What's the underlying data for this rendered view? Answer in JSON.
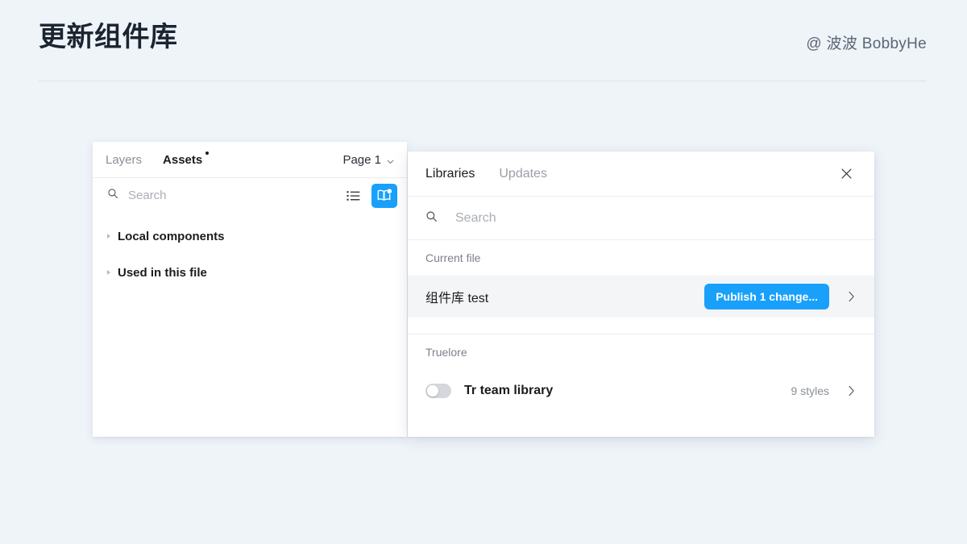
{
  "slide": {
    "title": "更新组件库",
    "author": "@ 波波 BobbyHe"
  },
  "colors": {
    "background": "#eff4f9",
    "accent_blue": "#18a0fb",
    "panel": "#ffffff",
    "row_highlight": "#f4f5f6",
    "muted_text": "#8a8f96"
  },
  "assets_panel": {
    "tabs": [
      {
        "label": "Layers",
        "active": false
      },
      {
        "label": "Assets",
        "active": true,
        "has_dot": true
      }
    ],
    "page_selector": {
      "label": "Page 1",
      "icon": "chevron-down-icon"
    },
    "search": {
      "placeholder": "Search",
      "icon": "search-icon"
    },
    "view_toggle_icon": "list-view-icon",
    "library_button": {
      "icon": "book-icon",
      "badge": true
    },
    "tree": [
      {
        "label": "Local components",
        "expanded": false
      },
      {
        "label": "Used in this file",
        "expanded": false
      }
    ]
  },
  "libraries_panel": {
    "tabs": [
      {
        "label": "Libraries",
        "active": true
      },
      {
        "label": "Updates",
        "active": false
      }
    ],
    "close_icon": "close-icon",
    "search": {
      "placeholder": "Search",
      "icon": "search-icon"
    },
    "sections": [
      {
        "label": "Current file",
        "rows": [
          {
            "name": "组件库 test",
            "action_label": "Publish 1 change...",
            "chevron": "chevron-right-icon",
            "highlighted": true
          }
        ]
      },
      {
        "label": "Truelore",
        "rows": [
          {
            "name": "Tr team library",
            "meta": "9 styles",
            "toggle_on": false,
            "chevron": "chevron-right-icon",
            "highlighted": false
          }
        ]
      }
    ]
  }
}
